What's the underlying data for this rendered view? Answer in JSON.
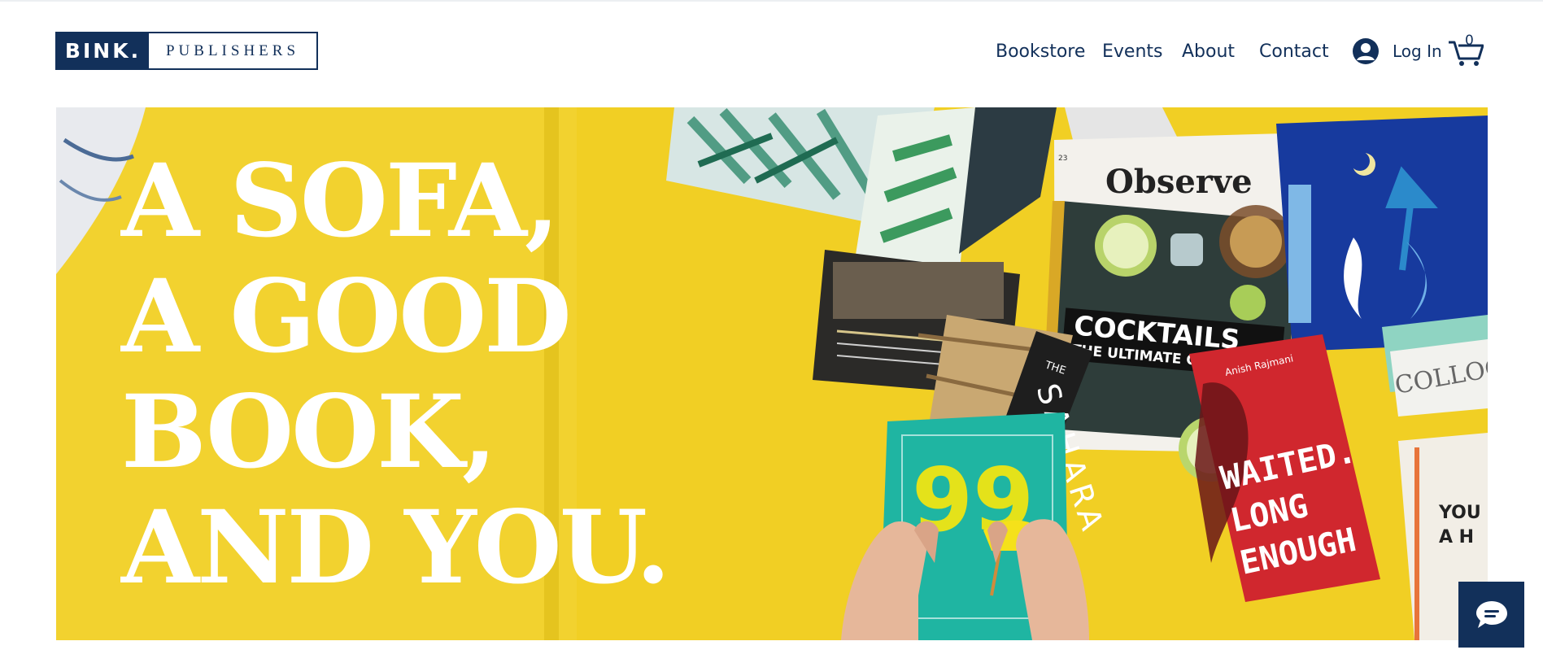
{
  "header": {
    "logo": {
      "primary": "BINK.",
      "secondary": "PUBLISHERS"
    },
    "nav": [
      {
        "label": "Bookstore"
      },
      {
        "label": "Events"
      },
      {
        "label": "About"
      },
      {
        "label": "Contact"
      }
    ],
    "login_label": "Log In",
    "cart_count": "0"
  },
  "hero": {
    "headline": [
      "A SOFA,",
      "A GOOD",
      "BOOK,",
      "AND YOU."
    ],
    "magazine_observe": "Observe",
    "magazine_cocktails_title": "COCKTAILS",
    "magazine_cocktails_subtitle": "THE ULTIMATE GUIDE",
    "book_sahara_the": "THE",
    "book_sahara_title": "SAHARA",
    "book_red_author": "Anish Rajmani",
    "book_red_title": [
      "WAITED.",
      "LONG",
      "ENOUGH"
    ],
    "book_colloq": "COLLOQ",
    "book_partial": [
      "YOU",
      "A H"
    ],
    "page_number": "23",
    "green_book_title": "99"
  },
  "colors": {
    "brand_navy": "#12305a",
    "sofa_yellow": "#f1cf24"
  },
  "icons": {
    "login": "user-circle-icon",
    "cart": "shopping-cart-icon",
    "chat": "chat-bubble-icon"
  }
}
